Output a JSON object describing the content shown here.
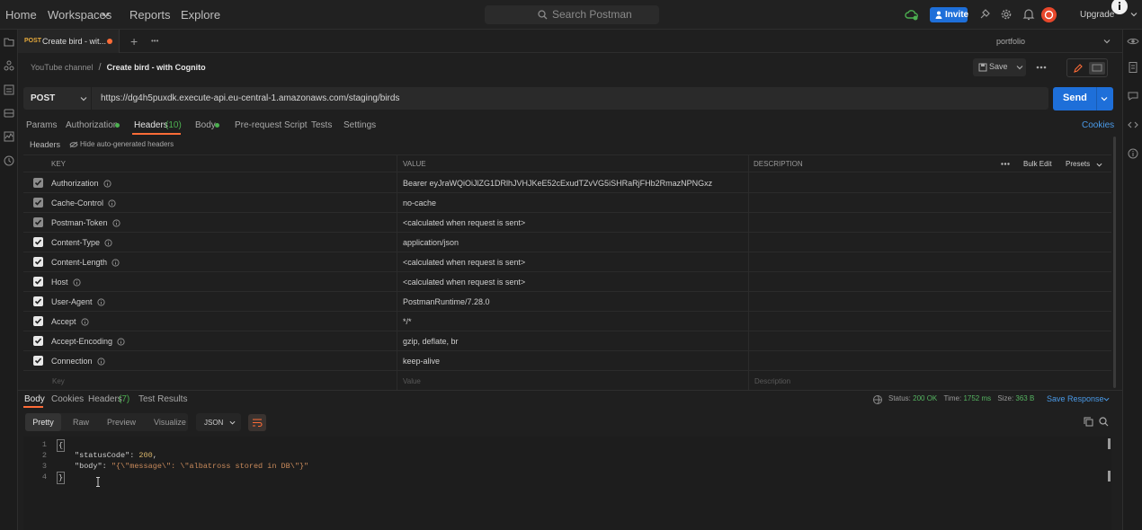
{
  "topnav": {
    "home": "Home",
    "workspaces": "Workspaces",
    "reports": "Reports",
    "explore": "Explore",
    "search_placeholder": "Search Postman",
    "invite": "Invite",
    "upgrade": "Upgrade"
  },
  "tab": {
    "method": "POST",
    "title": "Create bird - wit...",
    "add": "+",
    "more": "•••"
  },
  "environment": "portfolio",
  "breadcrumb": {
    "collection": "YouTube channel",
    "separator": "/",
    "request": "Create bird - with Cognito"
  },
  "actions": {
    "save": "Save"
  },
  "request": {
    "method": "POST",
    "url": "https://dg4h5puxdk.execute-api.eu-central-1.amazonaws.com/staging/birds",
    "send": "Send"
  },
  "reqtabs": {
    "params": "Params",
    "authorization": "Authorization",
    "headers": "Headers",
    "headers_count": "(10)",
    "body": "Body",
    "prerequest": "Pre-request Script",
    "tests": "Tests",
    "settings": "Settings",
    "cookies": "Cookies"
  },
  "subheader": {
    "title": "Headers",
    "hide": "Hide auto-generated headers"
  },
  "table": {
    "columns": {
      "key": "KEY",
      "value": "VALUE",
      "description": "DESCRIPTION"
    },
    "bulk_edit": "Bulk Edit",
    "presets": "Presets",
    "rows": [
      {
        "key": "Authorization",
        "value": "Bearer eyJraWQiOiJlZG1DRlhJVHJKeE52cExudTZvVG5iSHRaRjFHb2RmazNPNGxz",
        "checked": true,
        "auto": true
      },
      {
        "key": "Cache-Control",
        "value": "no-cache",
        "checked": true,
        "auto": true
      },
      {
        "key": "Postman-Token",
        "value": "<calculated when request is sent>",
        "checked": true,
        "auto": true
      },
      {
        "key": "Content-Type",
        "value": "application/json",
        "checked": true,
        "auto": false
      },
      {
        "key": "Content-Length",
        "value": "<calculated when request is sent>",
        "checked": true,
        "auto": false
      },
      {
        "key": "Host",
        "value": "<calculated when request is sent>",
        "checked": true,
        "auto": false
      },
      {
        "key": "User-Agent",
        "value": "PostmanRuntime/7.28.0",
        "checked": true,
        "auto": false
      },
      {
        "key": "Accept",
        "value": "*/*",
        "checked": true,
        "auto": false
      },
      {
        "key": "Accept-Encoding",
        "value": "gzip, deflate, br",
        "checked": true,
        "auto": false
      },
      {
        "key": "Connection",
        "value": "keep-alive",
        "checked": true,
        "auto": false
      }
    ],
    "placeholder": {
      "key": "Key",
      "value": "Value",
      "description": "Description"
    }
  },
  "response": {
    "tabs": {
      "body": "Body",
      "cookies": "Cookies",
      "headers": "Headers",
      "headers_count": "(7)",
      "test_results": "Test Results"
    },
    "status_label": "Status:",
    "status": "200 OK",
    "time_label": "Time:",
    "time": "1752 ms",
    "size_label": "Size:",
    "size": "363 B",
    "save": "Save Response",
    "views": {
      "pretty": "Pretty",
      "raw": "Raw",
      "preview": "Preview",
      "visualize": "Visualize",
      "format": "JSON"
    },
    "code": [
      {
        "n": "1",
        "text": "{"
      },
      {
        "n": "2",
        "key": "\"statusCode\"",
        "sep": ": ",
        "val": "200",
        "end": ","
      },
      {
        "n": "3",
        "key": "\"body\"",
        "sep": ": ",
        "val": "\"{\\\"message\\\": \\\"albatross stored in DB\\\"}\"",
        "end": ""
      },
      {
        "n": "4",
        "text": "}"
      }
    ]
  },
  "colors": {
    "accent": "#1e6fd9",
    "orange": "#ff6c37",
    "green": "#4caf50",
    "status": "#55b561"
  }
}
